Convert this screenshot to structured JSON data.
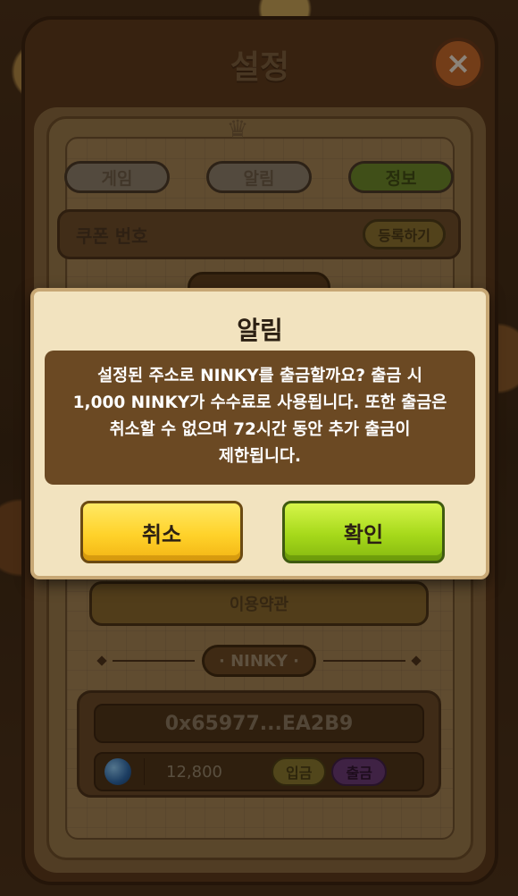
{
  "settings": {
    "title": "설정",
    "close_icon": "×",
    "tabs": [
      {
        "label": "게임",
        "active": false
      },
      {
        "label": "알림",
        "active": false
      },
      {
        "label": "정보",
        "active": true
      }
    ],
    "coupon": {
      "label": "쿠폰 번호",
      "button": "등록하기"
    },
    "terms_button": "이용약관",
    "ninky_section": {
      "label": "· NINKY ·",
      "address": "0x65977...EA2B9",
      "balance": "12,800",
      "deposit_button": "입금",
      "withdraw_button": "출금"
    }
  },
  "dialog": {
    "title": "알림",
    "message_lines": [
      "설정된 주소로 NINKY를 출금할까요? 출금 시",
      "1,000 NINKY가 수수료로 사용됩니다. 또한 출금은",
      "취소할 수 없으며 72시간 동안 추가 출금이",
      "제한됩니다."
    ],
    "cancel_button": "취소",
    "confirm_button": "확인"
  },
  "colors": {
    "cancel_yellow": "#ffd22a",
    "confirm_green": "#a6d91a",
    "dialog_panel": "#6b4923"
  }
}
